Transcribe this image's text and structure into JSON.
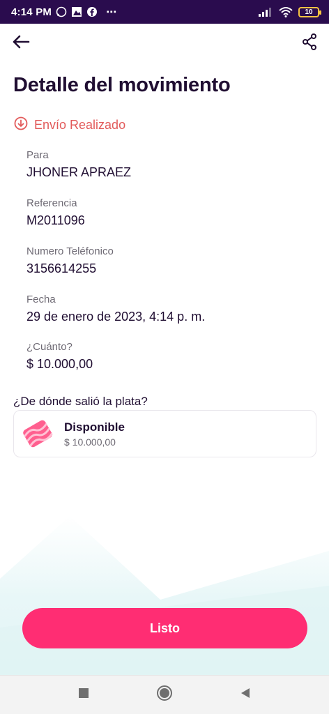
{
  "status_bar": {
    "time": "4:14 PM",
    "more": "⋯",
    "battery": "10"
  },
  "header": {
    "back_icon": "arrow-left-icon",
    "share_icon": "share-icon"
  },
  "page": {
    "title": "Detalle del movimiento",
    "status_icon": "arrow-down-circle-icon",
    "status_text": "Envío Realizado",
    "status_color": "#e25a5a"
  },
  "details": [
    {
      "label": "Para",
      "value": "JHONER APRAEZ"
    },
    {
      "label": "Referencia",
      "value": "M2011096"
    },
    {
      "label": "Numero Teléfonico",
      "value": "3156614255"
    },
    {
      "label": "Fecha",
      "value": "29 de enero de 2023, 4:14 p. m."
    },
    {
      "label": "¿Cuánto?",
      "value": "$ 10.000,00"
    }
  ],
  "source": {
    "title": "¿De dónde salió la plata?",
    "name": "Disponible",
    "amount": "$ 10.000,00",
    "icon": "pocket-icon"
  },
  "actions": {
    "done_label": "Listo",
    "accent_color": "#ff2d73"
  },
  "nav": {
    "recents_icon": "square-icon",
    "home_icon": "circle-icon",
    "back_icon": "triangle-back-icon"
  }
}
